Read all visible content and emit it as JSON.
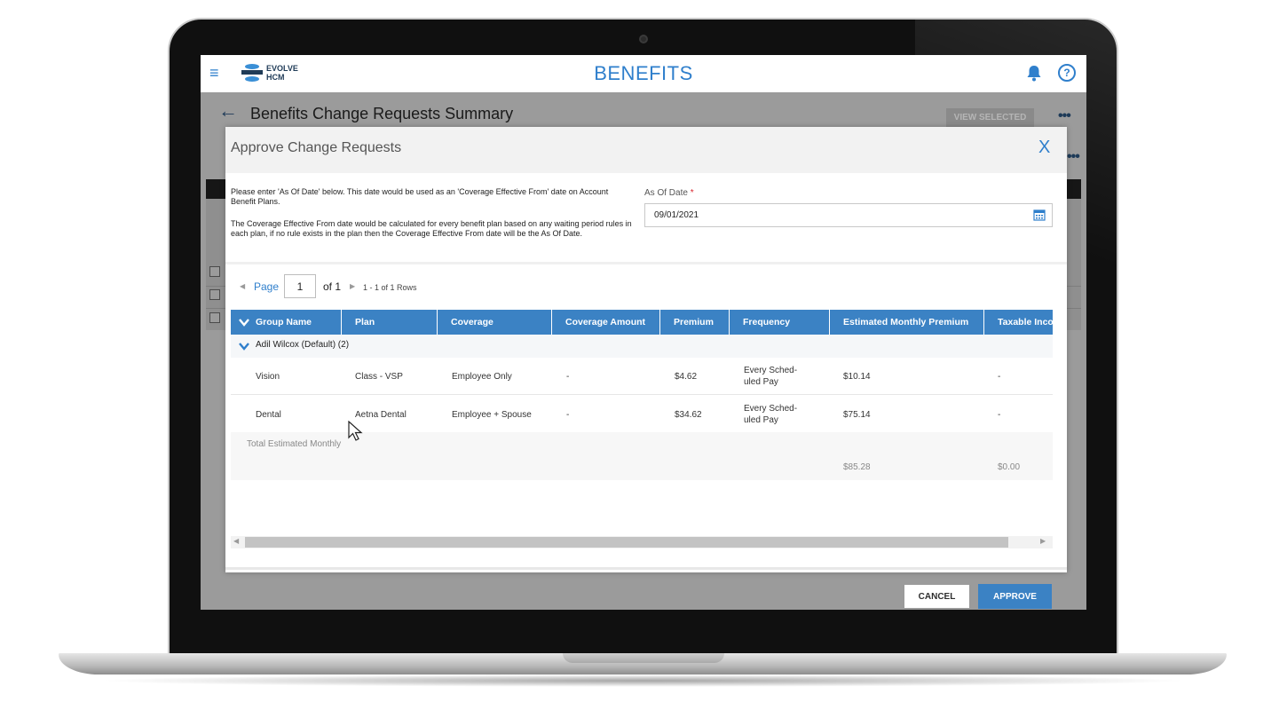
{
  "header": {
    "logo_text_line1": "EVOLVE",
    "logo_text_line2": "HCM",
    "app_title": "BENEFITS"
  },
  "page": {
    "title": "Benefits Change Requests Summary",
    "view_selected_label": "VIEW SELECTED"
  },
  "modal": {
    "title": "Approve Change Requests",
    "close_label": "X",
    "instruction_1": "Please enter 'As Of Date' below. This date would be used as an 'Coverage Effective From' date on Account Benefit Plans.",
    "instruction_2": "The Coverage Effective From date would be calculated for every benefit plan based on any waiting period rules in each plan, if no rule exists in the plan then the Coverage Effective From date will be the As Of Date.",
    "as_of_label": "As Of Date",
    "required_mark": "*",
    "as_of_value": "09/01/2021",
    "cancel_label": "CANCEL",
    "approve_label": "APPROVE"
  },
  "pager": {
    "page_label": "Page",
    "page_value": "1",
    "of_label": "of 1",
    "rows_label": "1 - 1 of 1 Rows"
  },
  "grid": {
    "columns": [
      "Group Name",
      "Plan",
      "Coverage",
      "Coverage Amount",
      "Premium",
      "Frequency",
      "Estimated Monthly Premium",
      "Taxable Inco"
    ],
    "group_label": "Adil Wilcox (Default) (2)",
    "rows": [
      {
        "group": "Vision",
        "plan": "Class - VSP",
        "coverage": "Employee Only",
        "amount": "-",
        "premium": "$4.62",
        "freq1": "Every Sched-",
        "freq2": "uled Pay",
        "est": "$10.14",
        "taxable": "-"
      },
      {
        "group": "Dental",
        "plan": "Aetna Dental",
        "coverage": "Employee + Spouse",
        "amount": "-",
        "premium": "$34.62",
        "freq1": "Every Sched-",
        "freq2": "uled Pay",
        "est": "$75.14",
        "taxable": "-"
      }
    ],
    "total_label": "Total Estimated Monthly",
    "total_est": "$85.28",
    "total_taxable": "$0.00"
  },
  "colors": {
    "accent": "#2f7fcc",
    "grid_header": "#3b82c4",
    "required": "#d9262e"
  }
}
